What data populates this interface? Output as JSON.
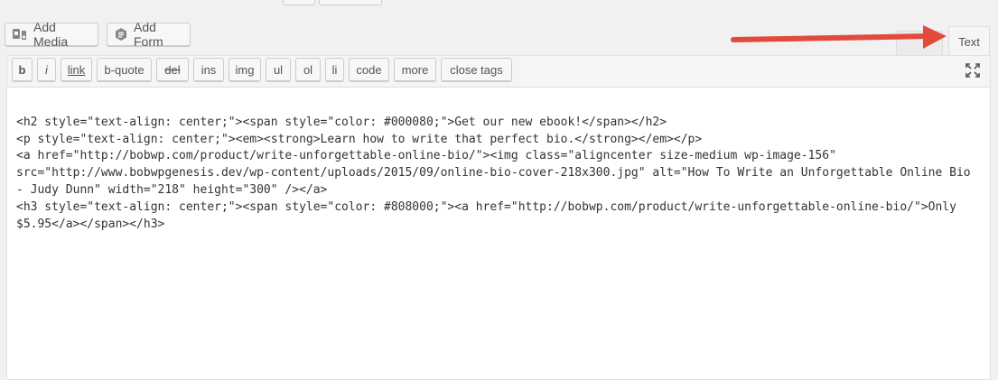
{
  "media_buttons": {
    "add_media": "Add Media",
    "add_form": "Add Form"
  },
  "tabs": {
    "visual": "",
    "text": "Text"
  },
  "quicktags": [
    "b",
    "i",
    "link",
    "b-quote",
    "del",
    "ins",
    "img",
    "ul",
    "ol",
    "li",
    "code",
    "more",
    "close tags"
  ],
  "code_lines": [
    "<h2 style=\"text-align: center;\"><span style=\"color: #000080;\">Get our new ebook!</span></h2>",
    "<p style=\"text-align: center;\"><em><strong>Learn how to write that perfect bio.</strong></em></p>",
    "<a href=\"http://bobwp.com/product/write-unforgettable-online-bio/\"><img class=\"aligncenter size-medium wp-image-156\"",
    "src=\"http://www.bobwpgenesis.dev/wp-content/uploads/2015/09/online-bio-cover-218x300.jpg\" alt=\"How To Write an Unforgettable Online Bio",
    "- Judy Dunn\" width=\"218\" height=\"300\" /></a>",
    "<h3 style=\"text-align: center;\"><span style=\"color: #808000;\"><a href=\"http://bobwp.com/product/write-unforgettable-online-bio/\">Only",
    "$5.95</a></span></h3>"
  ],
  "colors": {
    "arrow": "#e24a3b"
  },
  "icons": {
    "add_media": "media-icon",
    "add_form": "form-icon",
    "fullscreen": "expand-icon"
  }
}
